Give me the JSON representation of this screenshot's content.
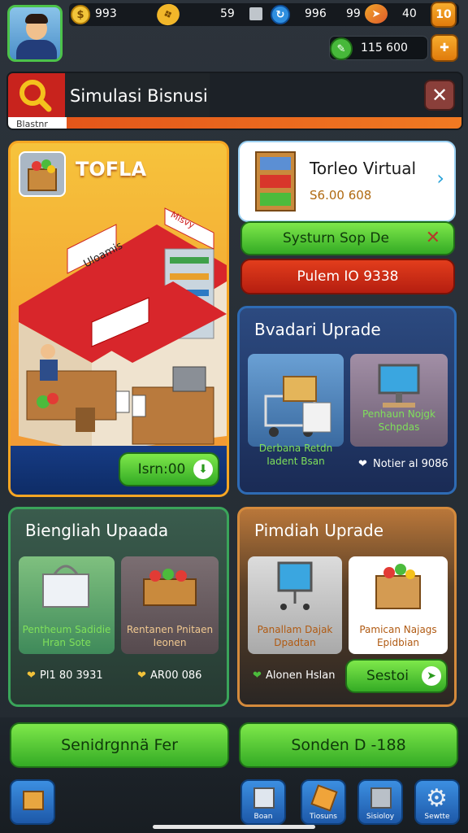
{
  "topbar": {
    "coins": "993",
    "gems": "59",
    "energy": "996",
    "rating": "99",
    "level": "40",
    "level_btn": "10",
    "cash": "115 600"
  },
  "header": {
    "title": "Simulasi Bisnusi",
    "subtitle": "Blastnr"
  },
  "store": {
    "title": "TOFLA",
    "sign1": "Uloamis",
    "sign2": "Misvy",
    "action_label": "Isrn:00"
  },
  "virtual_store": {
    "title": "Torleo Virtual",
    "price": "S6.00 608"
  },
  "system_button": "Systurn Sop De",
  "red_button": "Pulem IO 9338",
  "panel_blue": {
    "title": "Bvadari Uprade",
    "items": [
      {
        "label": "Derbana Retdn Iadent Bsan",
        "price": ""
      },
      {
        "label": "Penhaun Nojgk Schpdas",
        "price": "Notier al 9086"
      }
    ]
  },
  "panel_green": {
    "title": "Biengliah Upaada",
    "items": [
      {
        "label": "Pentheum Sadidie Hran Sote",
        "price": "Pl1 80 3931"
      },
      {
        "label": "Rentanen Pnitaen Ieonen",
        "price": "AR00 086"
      }
    ]
  },
  "panel_orange": {
    "title": "Pimdiah Uprade",
    "items": [
      {
        "label": "Panallam Dajak Dpadtan",
        "price": "Alonen Hslan"
      },
      {
        "label": "Pamican Najags Epidbian",
        "price": ""
      }
    ],
    "action_label": "Sestoi"
  },
  "bottom_buttons": [
    "Senidrgnnä Fer",
    "Sonden D -188"
  ],
  "nav": [
    {
      "label": "Boan"
    },
    {
      "label": "Tiosuns"
    },
    {
      "label": "Sisioloy"
    },
    {
      "label": "Sewtte"
    }
  ],
  "colors": {
    "green": "#4cc24a",
    "red": "#c8231d",
    "orange": "#f07a22",
    "blue": "#2e6bb4"
  }
}
